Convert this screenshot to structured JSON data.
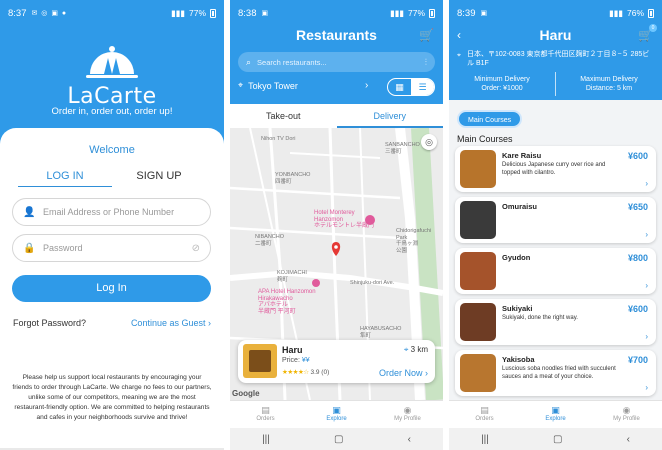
{
  "colors": {
    "primary": "#2f9ae8",
    "accent": "#2f8fd8",
    "star": "#f0b400",
    "map_pin": "#e53935"
  },
  "login": {
    "status": {
      "time": "8:37",
      "battery": "77%"
    },
    "brand": "LaCarte",
    "tagline": "Order in, order out, order up!",
    "welcome": "Welcome",
    "tabs": {
      "login": "LOG IN",
      "signup": "SIGN UP"
    },
    "email_placeholder": "Email Address or Phone Number",
    "password_placeholder": "Password",
    "login_button": "Log In",
    "forgot": "Forgot Password?",
    "guest": "Continue as Guest",
    "support_note": "Please help us support local restaurants by encouraging your friends to order through LaCarte. We charge no fees to our partners, unlike some of our competitors, meaning we are the most restaurant-friendly option. We are committed to helping restaurants and cafes in your neighborhoods survive and thrive!"
  },
  "restaurants": {
    "status": {
      "time": "8:38",
      "battery": "77%"
    },
    "title": "Restaurants",
    "search_placeholder": "Search restaurants...",
    "location": "Tokyo Tower",
    "tabs": {
      "takeout": "Take-out",
      "delivery": "Delivery"
    },
    "map_labels": {
      "sanbancho": "SANBANCHO\n三番町",
      "yonbancho": "YONBANCHO\n四番町",
      "nibancho": "NIBANCHO\n二番町",
      "kojimachi": "KOJIMACHI\n麹町",
      "hayabusacho": "HAYABUSACHO\n隼町",
      "chidorigafuchi": "Chidorigafuchi\nPark\n千鳥ヶ淵\n公園",
      "hotel_monterey": "Hotel Monterey\nHanzomon\nホテルモントレ半蔵門",
      "apa_hotel": "APA Hotel Hanzomon\nHirakawacho\nアパホテル\n半蔵門 平河町",
      "nihon_tv": "Nihon TV Dori",
      "shinjuku_dori": "Shinjuku-dori Ave.",
      "google": "Google"
    },
    "card": {
      "name": "Haru",
      "price_label": "Price:",
      "price_value": "¥¥",
      "stars": "★★★★☆",
      "rating": "3.9 (0)",
      "distance": "3 km",
      "order_now": "Order Now"
    },
    "nav": {
      "orders": "Orders",
      "explore": "Explore",
      "profile": "My Profile"
    }
  },
  "menu": {
    "status": {
      "time": "8:39",
      "battery": "76%"
    },
    "title": "Haru",
    "cart_count": "0",
    "address": "日本、〒102-0083 東京都千代田区麹町２丁目８−５ 285ビル B1F",
    "min_delivery_label": "Minimum Delivery",
    "min_delivery_value": "Order: ¥1000",
    "max_delivery_label": "Maximum Delivery",
    "max_delivery_value": "Distance: 5 km",
    "category_chip": "Main Courses",
    "section_title": "Main Courses",
    "items": [
      {
        "name": "Kare Raisu",
        "desc": "Delicious Japanese curry over rice and topped with cilantro.",
        "price": "¥600",
        "color": "#b7742b"
      },
      {
        "name": "Omuraisu",
        "desc": "",
        "price": "¥650",
        "color": "#3a3a3a"
      },
      {
        "name": "Gyudon",
        "desc": "",
        "price": "¥800",
        "color": "#a5532b"
      },
      {
        "name": "Sukiyaki",
        "desc": "Sukiyaki, done the right way.",
        "price": "¥600",
        "color": "#6e3c24"
      },
      {
        "name": "Yakisoba",
        "desc": "Luscious soba noodles fried with succulent sauces and a meat of your choice.",
        "price": "¥700",
        "color": "#b8762f"
      }
    ],
    "nav": {
      "orders": "Orders",
      "explore": "Explore",
      "profile": "My Profile"
    }
  }
}
